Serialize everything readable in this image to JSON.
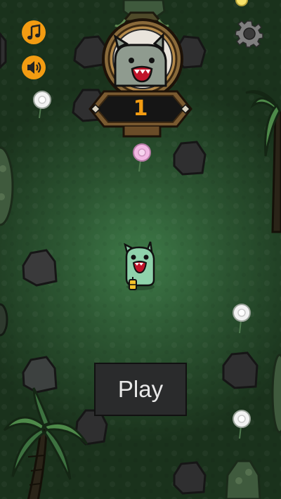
{
  "hud": {
    "score": "1",
    "music_icon": "music-note-icon",
    "sound_icon": "speaker-icon",
    "settings_icon": "gear-icon",
    "accent_color": "#f39c12"
  },
  "menu": {
    "play_label": "Play"
  },
  "scene": {
    "ground_color": "#1f3a21",
    "character": "green-monster-with-lantern"
  }
}
